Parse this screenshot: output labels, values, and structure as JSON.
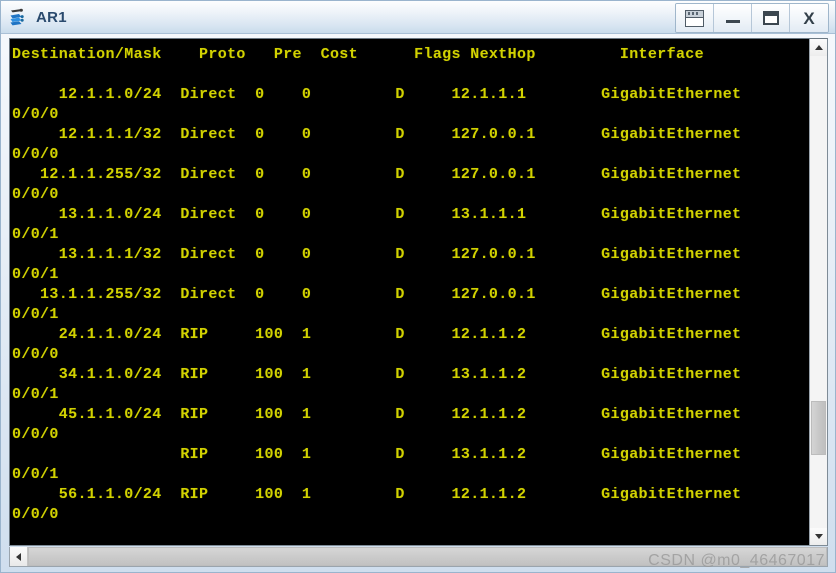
{
  "window": {
    "title": "AR1",
    "icon": "router-icon",
    "buttons": [
      {
        "name": "restore-window-button",
        "icon": "window-restore-icon",
        "label": ""
      },
      {
        "name": "minimize-button",
        "icon": "minimize-icon",
        "label": ""
      },
      {
        "name": "maximize-button",
        "icon": "maximize-icon",
        "label": ""
      },
      {
        "name": "close-button",
        "icon": "close-icon",
        "label": "X"
      }
    ]
  },
  "terminal": {
    "header": "Destination/Mask    Proto   Pre  Cost      Flags NextHop         Interface",
    "columns": [
      "Destination/Mask",
      "Proto",
      "Pre",
      "Cost",
      "Flags",
      "NextHop",
      "Interface"
    ],
    "foreground_color": "#d2d200",
    "background_color": "#000000",
    "rows": [
      {
        "destination": "12.1.1.0/24",
        "proto": "Direct",
        "pre": "0",
        "cost": "0",
        "flags": "D",
        "nexthop": "12.1.1.1",
        "interface": "GigabitEthernet",
        "interface_wrap": "0/0/0"
      },
      {
        "destination": "12.1.1.1/32",
        "proto": "Direct",
        "pre": "0",
        "cost": "0",
        "flags": "D",
        "nexthop": "127.0.0.1",
        "interface": "GigabitEthernet",
        "interface_wrap": "0/0/0"
      },
      {
        "destination": "12.1.1.255/32",
        "proto": "Direct",
        "pre": "0",
        "cost": "0",
        "flags": "D",
        "nexthop": "127.0.0.1",
        "interface": "GigabitEthernet",
        "interface_wrap": "0/0/0"
      },
      {
        "destination": "13.1.1.0/24",
        "proto": "Direct",
        "pre": "0",
        "cost": "0",
        "flags": "D",
        "nexthop": "13.1.1.1",
        "interface": "GigabitEthernet",
        "interface_wrap": "0/0/1"
      },
      {
        "destination": "13.1.1.1/32",
        "proto": "Direct",
        "pre": "0",
        "cost": "0",
        "flags": "D",
        "nexthop": "127.0.0.1",
        "interface": "GigabitEthernet",
        "interface_wrap": "0/0/1"
      },
      {
        "destination": "13.1.1.255/32",
        "proto": "Direct",
        "pre": "0",
        "cost": "0",
        "flags": "D",
        "nexthop": "127.0.0.1",
        "interface": "GigabitEthernet",
        "interface_wrap": "0/0/1"
      },
      {
        "destination": "24.1.1.0/24",
        "proto": "RIP",
        "pre": "100",
        "cost": "1",
        "flags": "D",
        "nexthop": "12.1.1.2",
        "interface": "GigabitEthernet",
        "interface_wrap": "0/0/0"
      },
      {
        "destination": "34.1.1.0/24",
        "proto": "RIP",
        "pre": "100",
        "cost": "1",
        "flags": "D",
        "nexthop": "13.1.1.2",
        "interface": "GigabitEthernet",
        "interface_wrap": "0/0/1"
      },
      {
        "destination": "45.1.1.0/24",
        "proto": "RIP",
        "pre": "100",
        "cost": "1",
        "flags": "D",
        "nexthop": "12.1.1.2",
        "interface": "GigabitEthernet",
        "interface_wrap": "0/0/0"
      },
      {
        "destination": "",
        "proto": "RIP",
        "pre": "100",
        "cost": "1",
        "flags": "D",
        "nexthop": "13.1.1.2",
        "interface": "GigabitEthernet",
        "interface_wrap": "0/0/1"
      },
      {
        "destination": "56.1.1.0/24",
        "proto": "RIP",
        "pre": "100",
        "cost": "1",
        "flags": "D",
        "nexthop": "12.1.1.2",
        "interface": "GigabitEthernet",
        "interface_wrap": "0/0/0"
      }
    ]
  },
  "scrollbars": {
    "vertical": {
      "up_arrow": "chevron-up-icon",
      "down_arrow": "chevron-down-icon",
      "thumb_top_percent": 73,
      "thumb_height_percent": 11.5
    },
    "horizontal": {
      "left_arrow": "chevron-left-icon"
    }
  },
  "watermark": {
    "text": "CSDN @m0_46467017"
  }
}
